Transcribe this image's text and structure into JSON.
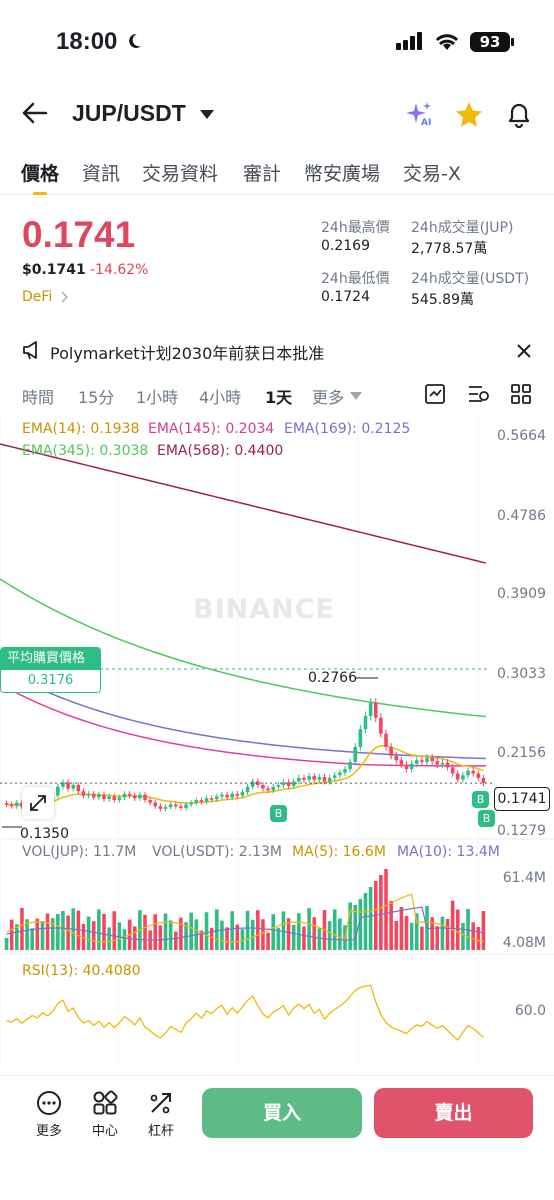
{
  "status_bar": {
    "time": "18:00",
    "battery": "93"
  },
  "header": {
    "pair": "JUP/USDT",
    "ai_badge": "AI"
  },
  "tabs": [
    "價格",
    "資訊",
    "交易資料",
    "審計",
    "幣安廣場",
    "交易-X"
  ],
  "ticker": {
    "price": "0.1741",
    "usd_price": "$0.1741",
    "change": "-14.62%",
    "tag": "DeFi",
    "stats": {
      "high_label": "24h最高價",
      "high": "0.2169",
      "low_label": "24h最低價",
      "low": "0.1724",
      "vol_base_label": "24h成交量(JUP)",
      "vol_base": "2,778.57萬",
      "vol_quote_label": "24h成交量(USDT)",
      "vol_quote": "545.89萬"
    }
  },
  "news": {
    "text": "Polymarket计划2030年前获日本批准"
  },
  "intervals": [
    "時間",
    "15分",
    "1小時",
    "4小時",
    "1天",
    "更多"
  ],
  "chart_indicators": {
    "ema14": "EMA(14): 0.1938",
    "ema145": "EMA(145): 0.2034",
    "ema169": "EMA(169): 0.2125",
    "ema345": "EMA(345): 0.3038",
    "ema568": "EMA(568): 0.4400",
    "avg_buy_label": "平均購買價格",
    "avg_buy_value": "0.3176",
    "watermark": "BINANCE",
    "high_mark": "0.2766",
    "low_mark": "0.1350",
    "current_tag": "0.1741",
    "buy_marker": "B"
  },
  "price_axis": [
    "0.5664",
    "0.4786",
    "0.3909",
    "0.3033",
    "0.2156",
    "0.1279"
  ],
  "volume": {
    "jup": "VOL(JUP): 11.7M",
    "usdt": "VOL(USDT): 2.13M",
    "ma5": "MA(5): 16.6M",
    "ma10": "MA(10): 13.4M",
    "axis_top": "61.4M",
    "axis_bottom": "4.08M"
  },
  "rsi": {
    "label": "RSI(13): 40.4080",
    "axis": "60.0"
  },
  "bottom_nav": [
    {
      "label": "更多",
      "icon": "more-icon"
    },
    {
      "label": "中心",
      "icon": "grid-icon"
    },
    {
      "label": "杠杆",
      "icon": "leverage-icon"
    }
  ],
  "actions": {
    "buy": "買入",
    "sell": "賣出"
  },
  "colors": {
    "up": "#2ebd85",
    "down": "#f6465d",
    "accent": "#f0b90b",
    "ema14": "#f0b90b",
    "ema145": "#e040a0",
    "ema169": "#7b6fd0",
    "ema345": "#52c75a",
    "ema568": "#a0204a",
    "buy_button": "#5dbb85",
    "sell_button": "#e0536a"
  },
  "chart_data": {
    "type": "candlestick",
    "title": "JUP/USDT 1天",
    "y_axis": [
      0.1279,
      0.2156,
      0.3033,
      0.3909,
      0.4786,
      0.5664
    ],
    "close": [
      0.15,
      0.148,
      0.152,
      0.147,
      0.151,
      0.155,
      0.153,
      0.158,
      0.156,
      0.16,
      0.17,
      0.175,
      0.168,
      0.172,
      0.165,
      0.16,
      0.162,
      0.158,
      0.161,
      0.156,
      0.159,
      0.155,
      0.158,
      0.162,
      0.16,
      0.157,
      0.161,
      0.155,
      0.152,
      0.148,
      0.145,
      0.147,
      0.15,
      0.148,
      0.146,
      0.15,
      0.152,
      0.155,
      0.153,
      0.157,
      0.156,
      0.159,
      0.161,
      0.158,
      0.162,
      0.16,
      0.164,
      0.17,
      0.176,
      0.172,
      0.168,
      0.166,
      0.17,
      0.172,
      0.175,
      0.171,
      0.176,
      0.18,
      0.178,
      0.182,
      0.178,
      0.181,
      0.176,
      0.18,
      0.183,
      0.186,
      0.19,
      0.198,
      0.215,
      0.235,
      0.25,
      0.265,
      0.248,
      0.23,
      0.215,
      0.205,
      0.2,
      0.195,
      0.19,
      0.196,
      0.2,
      0.198,
      0.203,
      0.199,
      0.195,
      0.197,
      0.192,
      0.185,
      0.178,
      0.183,
      0.188,
      0.185,
      0.18,
      0.1741
    ]
  }
}
